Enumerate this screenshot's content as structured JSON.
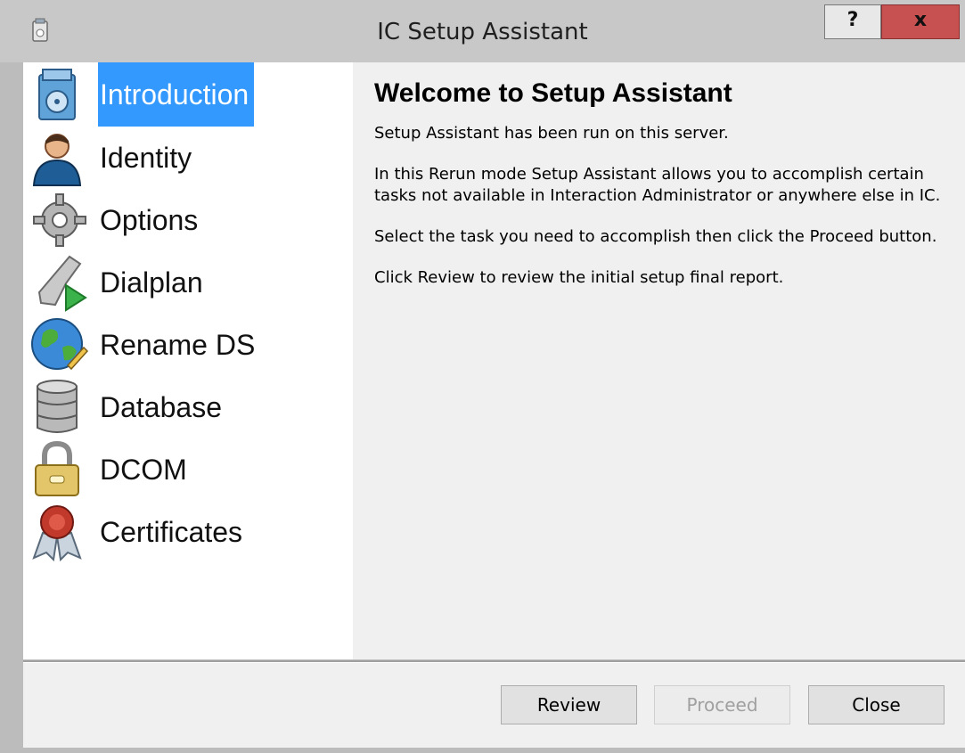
{
  "window": {
    "title": "IC Setup Assistant",
    "help_label": "?",
    "close_label": "x"
  },
  "sidebar": {
    "items": [
      {
        "label": "Introduction",
        "icon": "setup-box-icon",
        "selected": true
      },
      {
        "label": "Identity",
        "icon": "user-icon",
        "selected": false
      },
      {
        "label": "Options",
        "icon": "gear-icon",
        "selected": false
      },
      {
        "label": "Dialplan",
        "icon": "phone-play-icon",
        "selected": false
      },
      {
        "label": "Rename DS",
        "icon": "globe-pencil-icon",
        "selected": false
      },
      {
        "label": "Database",
        "icon": "database-icon",
        "selected": false
      },
      {
        "label": "DCOM",
        "icon": "lock-icon",
        "selected": false
      },
      {
        "label": "Certificates",
        "icon": "certificate-seal-icon",
        "selected": false
      }
    ]
  },
  "main": {
    "heading": "Welcome to Setup Assistant",
    "paragraphs": [
      "Setup Assistant has been run on this server.",
      "In this Rerun mode Setup Assistant allows you to accomplish certain tasks not available in Interaction Administrator or anywhere else in IC.",
      "Select the task you need to accomplish then click the Proceed button.",
      "Click Review to review the initial setup final report."
    ]
  },
  "footer": {
    "review_label": "Review",
    "proceed_label": "Proceed",
    "proceed_enabled": false,
    "close_label": "Close"
  },
  "colors": {
    "selection": "#3399ff",
    "close_button": "#c75050"
  }
}
